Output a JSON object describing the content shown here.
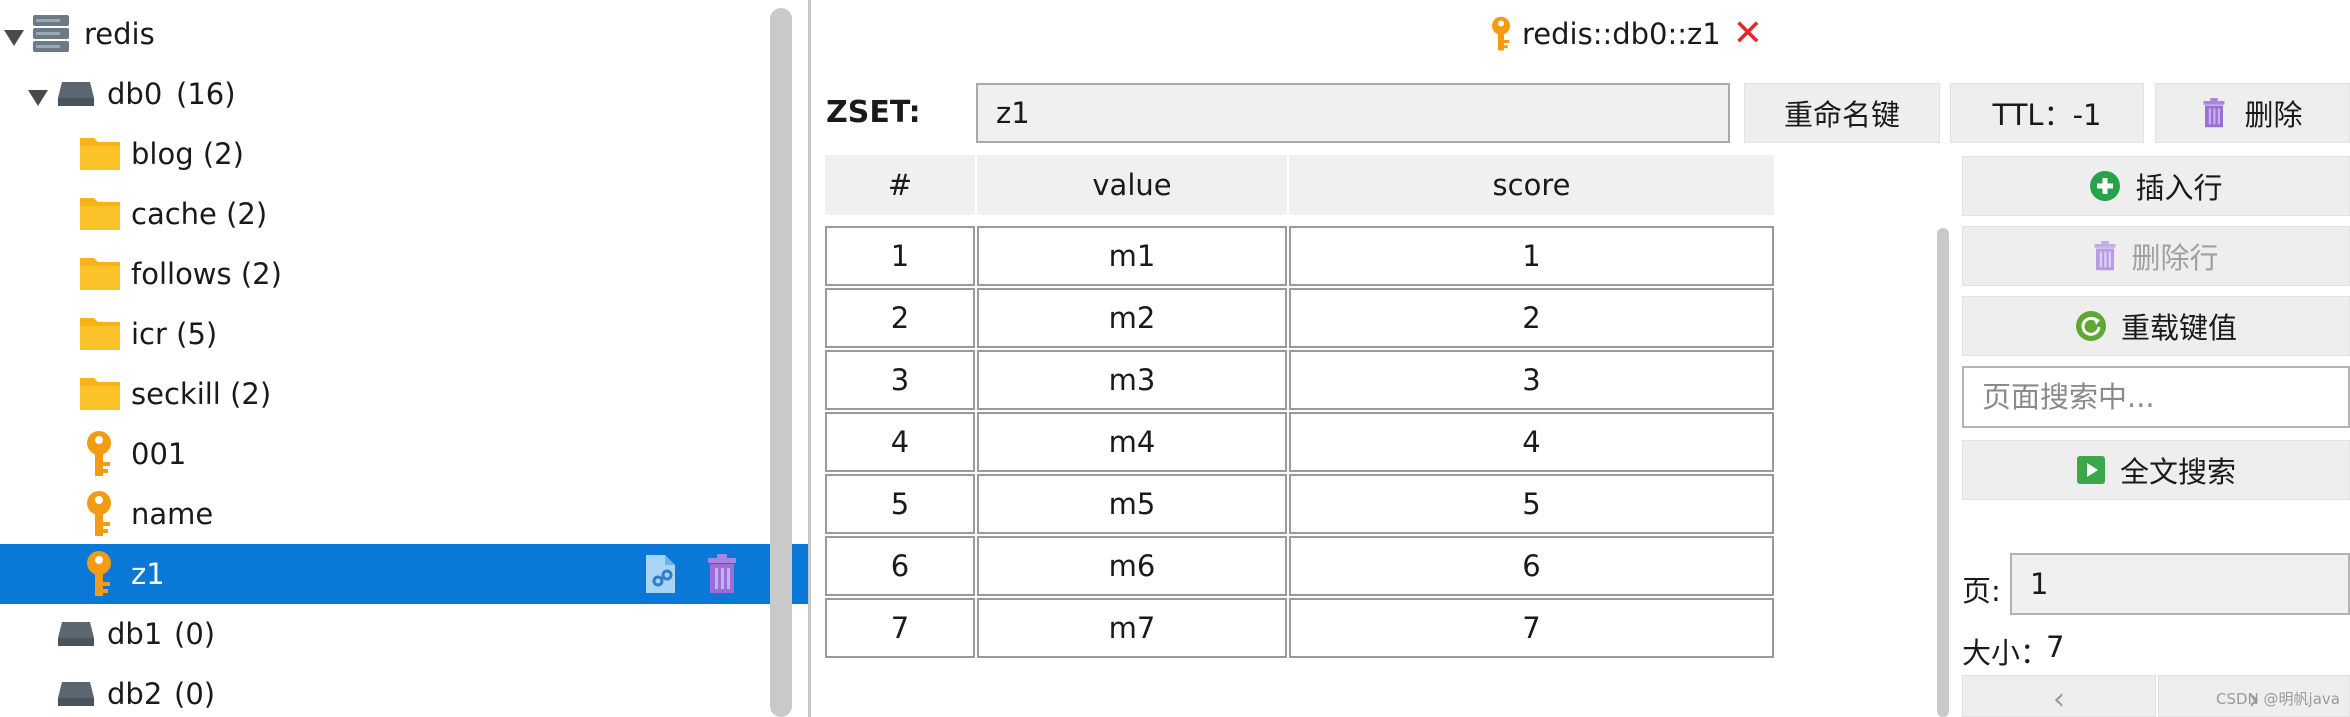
{
  "tree": {
    "root": {
      "label": "redis"
    },
    "db0": {
      "label": "db0",
      "count": "(16)"
    },
    "folders": [
      {
        "label": "blog (2)"
      },
      {
        "label": "cache (2)"
      },
      {
        "label": "follows (2)"
      },
      {
        "label": "icr (5)"
      },
      {
        "label": "seckill (2)"
      }
    ],
    "keys": [
      {
        "label": "001"
      },
      {
        "label": "name"
      },
      {
        "label": "z1"
      }
    ],
    "other_dbs": [
      {
        "label": "db1",
        "count": "(0)"
      },
      {
        "label": "db2",
        "count": "(0)"
      }
    ]
  },
  "tab": {
    "title": "redis::db0::z1",
    "close": "✕"
  },
  "toolbar": {
    "type_label": "ZSET:",
    "key_value": "z1",
    "rename_label": "重命名键",
    "ttl_label": "TTL：-1",
    "delete_label": "删除"
  },
  "table": {
    "headers": [
      "#",
      "value",
      "score"
    ],
    "rows": [
      [
        "1",
        "m1",
        "1"
      ],
      [
        "2",
        "m2",
        "2"
      ],
      [
        "3",
        "m3",
        "3"
      ],
      [
        "4",
        "m4",
        "4"
      ],
      [
        "5",
        "m5",
        "5"
      ],
      [
        "6",
        "m6",
        "6"
      ],
      [
        "7",
        "m7",
        "7"
      ]
    ]
  },
  "side": {
    "insert_row": "插入行",
    "delete_row": "删除行",
    "reload": "重载键值",
    "search_placeholder": "页面搜索中...",
    "full_search": "全文搜索",
    "page_label": "页:",
    "page_value": "1",
    "size_label": "大小：",
    "size_value": "7",
    "prev": "‹",
    "next": "›"
  },
  "watermark": "CSDN @明帆java",
  "colors": {
    "selection": "#0a78d7",
    "folder": "#f8b417",
    "key": "#f39c12",
    "trash": "#9b6fd6",
    "close": "#e0272b",
    "add_green": "#25a24a"
  }
}
